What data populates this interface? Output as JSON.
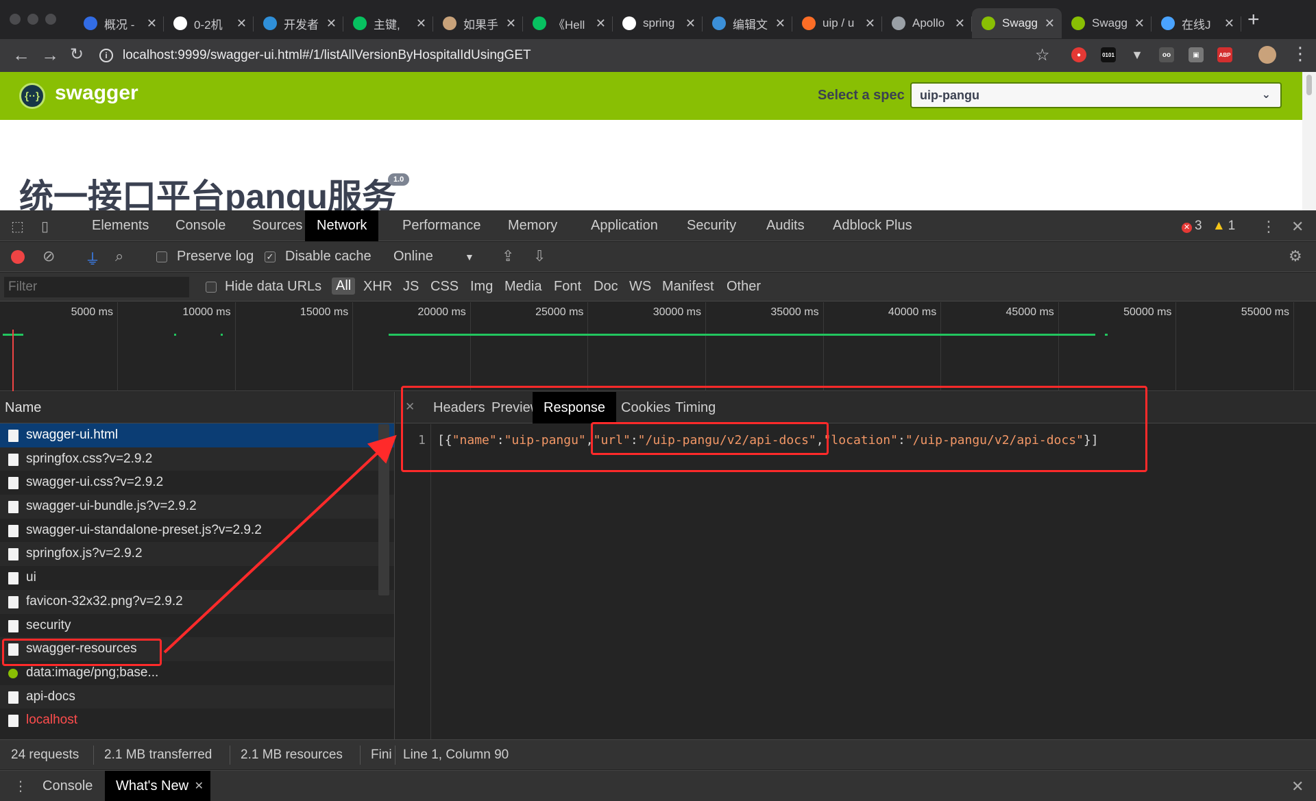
{
  "browser": {
    "tabs": [
      {
        "title": "概况 -",
        "icon": "helm-icon",
        "color": "#326ce5"
      },
      {
        "title": "0-2机",
        "icon": "globe-icon",
        "color": "#ffffff"
      },
      {
        "title": "开发者",
        "icon": "window-icon",
        "color": "#2f8fd8"
      },
      {
        "title": "主键,",
        "icon": "wechat-icon",
        "color": "#07c160"
      },
      {
        "title": "如果手",
        "icon": "image-icon",
        "color": "#c8a27a"
      },
      {
        "title": "《Hell",
        "icon": "wechat-icon",
        "color": "#07c160"
      },
      {
        "title": "spring",
        "icon": "github-icon",
        "color": "#ffffff"
      },
      {
        "title": "编辑文",
        "icon": "editor-icon",
        "color": "#3b8fd8"
      },
      {
        "title": "uip / u",
        "icon": "gitlab-icon",
        "color": "#fc6d26"
      },
      {
        "title": "Apollo",
        "icon": "apollo-icon",
        "color": "#9aa0a6"
      },
      {
        "title": "Swagg",
        "icon": "swagger-icon",
        "color": "#89bf04",
        "active": true
      },
      {
        "title": "Swagg",
        "icon": "swagger-icon",
        "color": "#89bf04"
      },
      {
        "title": "在线J",
        "icon": "code-icon",
        "color": "#4aa3ff"
      }
    ],
    "url": "localhost:9999/swagger-ui.html#/1/listAllVersionByHospitalIdUsingGET"
  },
  "swagger": {
    "brand": "swagger",
    "select_label": "Select a spec",
    "selected_spec": "uip-pangu",
    "page_title": "统一接口平台pangu服务",
    "version": "1.0"
  },
  "devtools": {
    "tabs": [
      "Elements",
      "Console",
      "Sources",
      "Network",
      "Performance",
      "Memory",
      "Application",
      "Security",
      "Audits",
      "Adblock Plus"
    ],
    "active_tab": "Network",
    "errors": "3",
    "warnings": "1",
    "toolbar": {
      "preserve_log": "Preserve log",
      "disable_cache": "Disable cache",
      "throttle": "Online"
    },
    "filter": {
      "placeholder": "Filter",
      "hide_data_urls": "Hide data URLs",
      "types": [
        "All",
        "XHR",
        "JS",
        "CSS",
        "Img",
        "Media",
        "Font",
        "Doc",
        "WS",
        "Manifest",
        "Other"
      ]
    },
    "overview_ticks": [
      "5000 ms",
      "10000 ms",
      "15000 ms",
      "20000 ms",
      "25000 ms",
      "30000 ms",
      "35000 ms",
      "40000 ms",
      "45000 ms",
      "50000 ms",
      "55000 ms"
    ],
    "requests_header": "Name",
    "requests": [
      "swagger-ui.html",
      "springfox.css?v=2.9.2",
      "swagger-ui.css?v=2.9.2",
      "swagger-ui-bundle.js?v=2.9.2",
      "swagger-ui-standalone-preset.js?v=2.9.2",
      "springfox.js?v=2.9.2",
      "ui",
      "favicon-32x32.png?v=2.9.2",
      "security",
      "swagger-resources",
      "data:image/png;base...",
      "api-docs",
      "localhost"
    ],
    "response_tabs": [
      "Headers",
      "Preview",
      "Response",
      "Cookies",
      "Timing"
    ],
    "active_response_tab": "Response",
    "response": {
      "line_number": "1",
      "p1": "[{",
      "k_name": "\"name\"",
      "v_name": "\"uip-pangu\"",
      "k_url": "\"url\"",
      "v_url": "\"/uip-pangu/v2/api-docs\"",
      "k_location": "\"location\"",
      "v_location": "\"/uip-pangu/v2/api-docs\"",
      "p_end": "}]"
    },
    "status": {
      "requests": "24 requests",
      "transferred": "2.1 MB transferred",
      "resources": "2.1 MB resources",
      "finish": "Fini",
      "cursor": "Line 1, Column 90"
    },
    "drawer_tabs": [
      "Console",
      "What's New"
    ]
  },
  "annotation_color": "#ff2a2a"
}
